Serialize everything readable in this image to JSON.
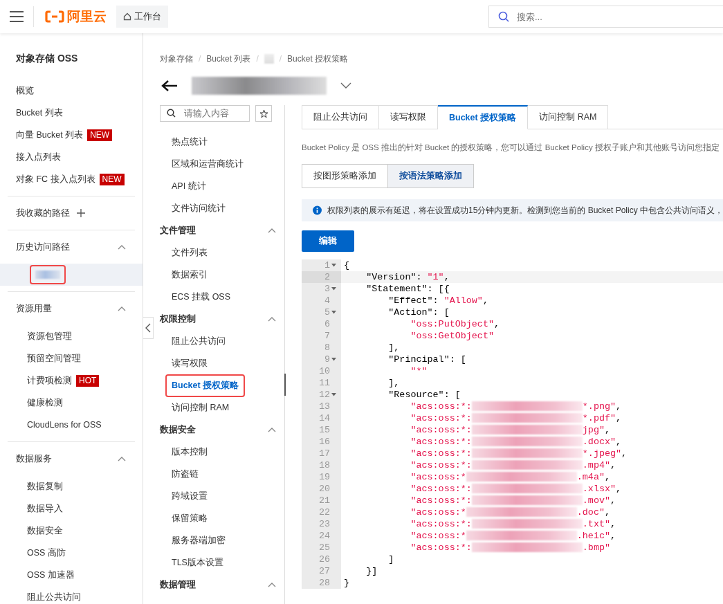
{
  "topbar": {
    "logo_text": "阿里云",
    "workbench": "工作台",
    "search": {
      "placeholder": "搜索..."
    }
  },
  "sidebar": {
    "title": "对象存储 OSS",
    "items": [
      {
        "label": "概览",
        "selected": false
      },
      {
        "label": "Bucket 列表",
        "selected": false
      },
      {
        "label": "向量 Bucket 列表",
        "badge": "NEW",
        "selected": false
      },
      {
        "label": "接入点列表",
        "selected": false
      },
      {
        "label": "对象 FC 接入点列表",
        "badge": "NEW",
        "selected": false
      }
    ],
    "favorites": "我收藏的路径",
    "sections": [
      {
        "title": "历史访问路径",
        "expanded": true,
        "items": [
          {
            "kind": "redacted",
            "selected": true,
            "highlighted": true
          }
        ]
      },
      {
        "title": "资源用量",
        "expanded": true,
        "items": [
          {
            "kind": "link",
            "label": "资源包管理",
            "selected": false,
            "highlighted": false
          },
          {
            "kind": "link",
            "label": "预留空间管理",
            "selected": false,
            "highlighted": false
          },
          {
            "kind": "link",
            "label": "计费项检测",
            "badge": "HOT",
            "selected": false,
            "highlighted": false
          },
          {
            "kind": "link",
            "label": "健康检测",
            "selected": false,
            "highlighted": false
          },
          {
            "kind": "link",
            "label": "CloudLens for OSS",
            "selected": false,
            "highlighted": false
          }
        ]
      },
      {
        "title": "数据服务",
        "expanded": true,
        "items": [
          {
            "kind": "link",
            "label": "数据复制",
            "selected": false,
            "highlighted": false
          },
          {
            "kind": "link",
            "label": "数据导入",
            "selected": false,
            "highlighted": false
          },
          {
            "kind": "link",
            "label": "数据安全",
            "selected": false,
            "highlighted": false
          },
          {
            "kind": "link",
            "label": "OSS 高防",
            "selected": false,
            "highlighted": false
          },
          {
            "kind": "link",
            "label": "OSS 加速器",
            "selected": false,
            "highlighted": false
          },
          {
            "kind": "link",
            "label": "阻止公共访问",
            "selected": false,
            "highlighted": false
          }
        ]
      }
    ]
  },
  "breadcrumb": {
    "separator": "/",
    "items": [
      {
        "kind": "text",
        "label": "对象存储"
      },
      {
        "kind": "text",
        "label": "Bucket 列表"
      },
      {
        "kind": "redacted"
      },
      {
        "kind": "text",
        "label": "Bucket 授权策略"
      }
    ]
  },
  "subnav": {
    "search": {
      "placeholder": "请输入内容"
    },
    "items": [
      {
        "label": "热点统计",
        "selected": false,
        "highlighted": false
      },
      {
        "label": "区域和运营商统计",
        "selected": false,
        "highlighted": false
      },
      {
        "label": "API 统计",
        "selected": false,
        "highlighted": false
      },
      {
        "label": "文件访问统计",
        "selected": false,
        "highlighted": false
      }
    ],
    "groups": [
      {
        "title": "文件管理",
        "expanded": true,
        "items": [
          {
            "label": "文件列表",
            "selected": false,
            "highlighted": false
          },
          {
            "label": "数据索引",
            "selected": false,
            "highlighted": false
          },
          {
            "label": "ECS 挂载 OSS",
            "selected": false,
            "highlighted": false
          }
        ]
      },
      {
        "title": "权限控制",
        "expanded": true,
        "items": [
          {
            "label": "阻止公共访问",
            "selected": false,
            "highlighted": false
          },
          {
            "label": "读写权限",
            "selected": false,
            "highlighted": false
          },
          {
            "label": "Bucket 授权策略",
            "selected": true,
            "highlighted": true
          },
          {
            "label": "访问控制 RAM",
            "selected": false,
            "highlighted": false
          }
        ]
      },
      {
        "title": "数据安全",
        "expanded": true,
        "items": [
          {
            "label": "版本控制",
            "selected": false,
            "highlighted": false
          },
          {
            "label": "防盗链",
            "selected": false,
            "highlighted": false
          },
          {
            "label": "跨域设置",
            "selected": false,
            "highlighted": false
          },
          {
            "label": "保留策略",
            "selected": false,
            "highlighted": false
          },
          {
            "label": "服务器端加密",
            "selected": false,
            "highlighted": false
          },
          {
            "label": "TLS版本设置",
            "selected": false,
            "highlighted": false
          }
        ]
      },
      {
        "title": "数据管理",
        "expanded": true
      }
    ]
  },
  "tabs": [
    {
      "label": "阻止公共访问",
      "selected": false
    },
    {
      "label": "读写权限",
      "selected": false
    },
    {
      "label": "Bucket 授权策略",
      "selected": true
    },
    {
      "label": "访问控制 RAM",
      "selected": false
    }
  ],
  "description": "Bucket Policy 是 OSS 推出的针对 Bucket 的授权策略，您可以通过 Bucket Policy 授权子账户和其他账号访问您指定",
  "mode_buttons": [
    {
      "label": "按图形策略添加",
      "selected": false
    },
    {
      "label": "按语法策略添加",
      "selected": true
    }
  ],
  "notice": "权限列表的展示有延迟，将在设置成功15分钟内更新。检测到您当前的 Bucket Policy 中包含公共访问语义，",
  "edit_button": "编辑",
  "editor": {
    "lines": [
      {
        "n": "1",
        "fold": true,
        "active": false,
        "parts": [
          {
            "kind": "plain",
            "text": "{"
          }
        ]
      },
      {
        "n": "2",
        "fold": false,
        "active": true,
        "parts": [
          {
            "kind": "plain",
            "text": "    \"Version\": "
          },
          {
            "kind": "string",
            "text": "\"1\""
          },
          {
            "kind": "plain",
            "text": ","
          }
        ]
      },
      {
        "n": "3",
        "fold": true,
        "active": false,
        "parts": [
          {
            "kind": "plain",
            "text": "    \"Statement\": [{"
          }
        ]
      },
      {
        "n": "4",
        "fold": false,
        "active": false,
        "parts": [
          {
            "kind": "plain",
            "text": "        \"Effect\": "
          },
          {
            "kind": "string",
            "text": "\"Allow\""
          },
          {
            "kind": "plain",
            "text": ","
          }
        ]
      },
      {
        "n": "5",
        "fold": true,
        "active": false,
        "parts": [
          {
            "kind": "plain",
            "text": "        \"Action\": ["
          }
        ]
      },
      {
        "n": "6",
        "fold": false,
        "active": false,
        "parts": [
          {
            "kind": "string",
            "text": "            \"oss:PutObject\""
          },
          {
            "kind": "plain",
            "text": ","
          }
        ]
      },
      {
        "n": "7",
        "fold": false,
        "active": false,
        "parts": [
          {
            "kind": "string",
            "text": "            \"oss:GetObject\""
          }
        ]
      },
      {
        "n": "8",
        "fold": false,
        "active": false,
        "parts": [
          {
            "kind": "plain",
            "text": "        ],"
          }
        ]
      },
      {
        "n": "9",
        "fold": true,
        "active": false,
        "parts": [
          {
            "kind": "plain",
            "text": "        \"Principal\": ["
          }
        ]
      },
      {
        "n": "10",
        "fold": false,
        "active": false,
        "parts": [
          {
            "kind": "string",
            "text": "            \"*\""
          }
        ]
      },
      {
        "n": "11",
        "fold": false,
        "active": false,
        "parts": [
          {
            "kind": "plain",
            "text": "        ],"
          }
        ]
      },
      {
        "n": "12",
        "fold": true,
        "active": false,
        "parts": [
          {
            "kind": "plain",
            "text": "        \"Resource\": ["
          }
        ]
      },
      {
        "n": "13",
        "fold": false,
        "active": false,
        "parts": [
          {
            "kind": "string",
            "text": "            \"acs:oss:*:"
          },
          {
            "kind": "redacted"
          },
          {
            "kind": "string",
            "text": "*.png\""
          },
          {
            "kind": "plain",
            "text": ","
          }
        ]
      },
      {
        "n": "14",
        "fold": false,
        "active": false,
        "parts": [
          {
            "kind": "string",
            "text": "            \"acs:oss:*:"
          },
          {
            "kind": "redacted"
          },
          {
            "kind": "string",
            "text": "*.pdf\""
          },
          {
            "kind": "plain",
            "text": ","
          }
        ]
      },
      {
        "n": "15",
        "fold": false,
        "active": false,
        "parts": [
          {
            "kind": "string",
            "text": "            \"acs:oss:*:"
          },
          {
            "kind": "redacted"
          },
          {
            "kind": "string",
            "text": "jpg\""
          },
          {
            "kind": "plain",
            "text": ","
          }
        ]
      },
      {
        "n": "16",
        "fold": false,
        "active": false,
        "parts": [
          {
            "kind": "string",
            "text": "            \"acs:oss:*:"
          },
          {
            "kind": "redacted"
          },
          {
            "kind": "string",
            "text": ".docx\""
          },
          {
            "kind": "plain",
            "text": ","
          }
        ]
      },
      {
        "n": "17",
        "fold": false,
        "active": false,
        "parts": [
          {
            "kind": "string",
            "text": "            \"acs:oss:*:"
          },
          {
            "kind": "redacted"
          },
          {
            "kind": "string",
            "text": "*.jpeg\""
          },
          {
            "kind": "plain",
            "text": ","
          }
        ]
      },
      {
        "n": "18",
        "fold": false,
        "active": false,
        "parts": [
          {
            "kind": "string",
            "text": "            \"acs:oss:*:"
          },
          {
            "kind": "redacted"
          },
          {
            "kind": "string",
            "text": ".mp4\""
          },
          {
            "kind": "plain",
            "text": ","
          }
        ]
      },
      {
        "n": "19",
        "fold": false,
        "active": false,
        "parts": [
          {
            "kind": "string",
            "text": "            \"acs:oss:*"
          },
          {
            "kind": "redacted"
          },
          {
            "kind": "string",
            "text": ".m4a\""
          },
          {
            "kind": "plain",
            "text": ","
          }
        ]
      },
      {
        "n": "20",
        "fold": false,
        "active": false,
        "parts": [
          {
            "kind": "string",
            "text": "            \"acs:oss:*:"
          },
          {
            "kind": "redacted"
          },
          {
            "kind": "string",
            "text": ".xlsx\""
          },
          {
            "kind": "plain",
            "text": ","
          }
        ]
      },
      {
        "n": "21",
        "fold": false,
        "active": false,
        "parts": [
          {
            "kind": "string",
            "text": "            \"acs:oss:*:"
          },
          {
            "kind": "redacted"
          },
          {
            "kind": "string",
            "text": ".mov\""
          },
          {
            "kind": "plain",
            "text": ","
          }
        ]
      },
      {
        "n": "22",
        "fold": false,
        "active": false,
        "parts": [
          {
            "kind": "string",
            "text": "            \"acs:oss:*"
          },
          {
            "kind": "redacted"
          },
          {
            "kind": "string",
            "text": ".doc\""
          },
          {
            "kind": "plain",
            "text": ","
          }
        ]
      },
      {
        "n": "23",
        "fold": false,
        "active": false,
        "parts": [
          {
            "kind": "string",
            "text": "            \"acs:oss:*:"
          },
          {
            "kind": "redacted"
          },
          {
            "kind": "string",
            "text": ".txt\""
          },
          {
            "kind": "plain",
            "text": ","
          }
        ]
      },
      {
        "n": "24",
        "fold": false,
        "active": false,
        "parts": [
          {
            "kind": "string",
            "text": "            \"acs:oss:*"
          },
          {
            "kind": "redacted"
          },
          {
            "kind": "string",
            "text": ".heic\""
          },
          {
            "kind": "plain",
            "text": ","
          }
        ]
      },
      {
        "n": "25",
        "fold": false,
        "active": false,
        "parts": [
          {
            "kind": "string",
            "text": "            \"acs:oss:*:"
          },
          {
            "kind": "redacted"
          },
          {
            "kind": "string",
            "text": ".bmp\""
          }
        ]
      },
      {
        "n": "26",
        "fold": false,
        "active": false,
        "parts": [
          {
            "kind": "plain",
            "text": "        ]"
          }
        ]
      },
      {
        "n": "27",
        "fold": false,
        "active": false,
        "parts": [
          {
            "kind": "plain",
            "text": "    }]"
          }
        ]
      },
      {
        "n": "28",
        "fold": false,
        "active": false,
        "parts": [
          {
            "kind": "plain",
            "text": "}"
          }
        ]
      }
    ]
  }
}
